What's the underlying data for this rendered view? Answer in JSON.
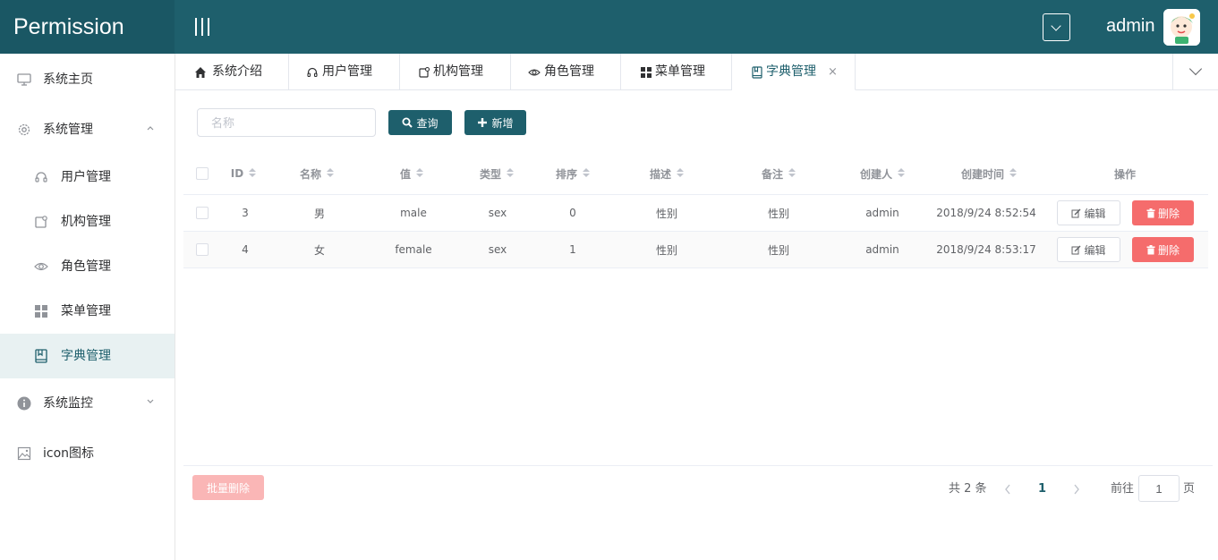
{
  "app": {
    "brand": "Permission",
    "user": "admin"
  },
  "sidebar": {
    "items": [
      {
        "label": "系统主页",
        "icon": "monitor-icon"
      },
      {
        "label": "系统管理",
        "icon": "gear-icon"
      },
      {
        "label": "用户管理",
        "icon": "headset-icon"
      },
      {
        "label": "机构管理",
        "icon": "org-icon"
      },
      {
        "label": "角色管理",
        "icon": "eye-icon"
      },
      {
        "label": "菜单管理",
        "icon": "grid-icon"
      },
      {
        "label": "字典管理",
        "icon": "dictionary-icon"
      },
      {
        "label": "系统监控",
        "icon": "info-icon"
      },
      {
        "label": "icon图标",
        "icon": "image-icon"
      }
    ]
  },
  "tabs": [
    {
      "label": "系统介绍",
      "icon": "home-icon"
    },
    {
      "label": "用户管理",
      "icon": "headset-icon"
    },
    {
      "label": "机构管理",
      "icon": "org-icon"
    },
    {
      "label": "角色管理",
      "icon": "eye-icon"
    },
    {
      "label": "菜单管理",
      "icon": "grid-icon"
    },
    {
      "label": "字典管理",
      "icon": "dictionary-icon",
      "active": true,
      "close": "×"
    }
  ],
  "toolbar": {
    "search_placeholder": "名称",
    "query_label": "查询",
    "add_label": "新增"
  },
  "table": {
    "columns": [
      "ID",
      "名称",
      "值",
      "类型",
      "排序",
      "描述",
      "备注",
      "创建人",
      "创建时间",
      "操作"
    ],
    "rows": [
      {
        "id": "3",
        "name": "男",
        "value": "male",
        "type": "sex",
        "sort": "0",
        "desc": "性别",
        "remark": "性别",
        "creator": "admin",
        "created": "2018/9/24 8:52:54"
      },
      {
        "id": "4",
        "name": "女",
        "value": "female",
        "type": "sex",
        "sort": "1",
        "desc": "性别",
        "remark": "性别",
        "creator": "admin",
        "created": "2018/9/24 8:53:17"
      }
    ],
    "edit_label": "编辑",
    "delete_label": "删除"
  },
  "footer": {
    "batch_delete_label": "批量删除",
    "total_text": "共 2 条",
    "current_page": "1",
    "goto_prefix": "前往",
    "goto_value": "1",
    "goto_suffix": "页"
  },
  "colors": {
    "primary": "#1e5f6c",
    "danger": "#f56c6c",
    "danger_disabled": "#fab6b6"
  }
}
